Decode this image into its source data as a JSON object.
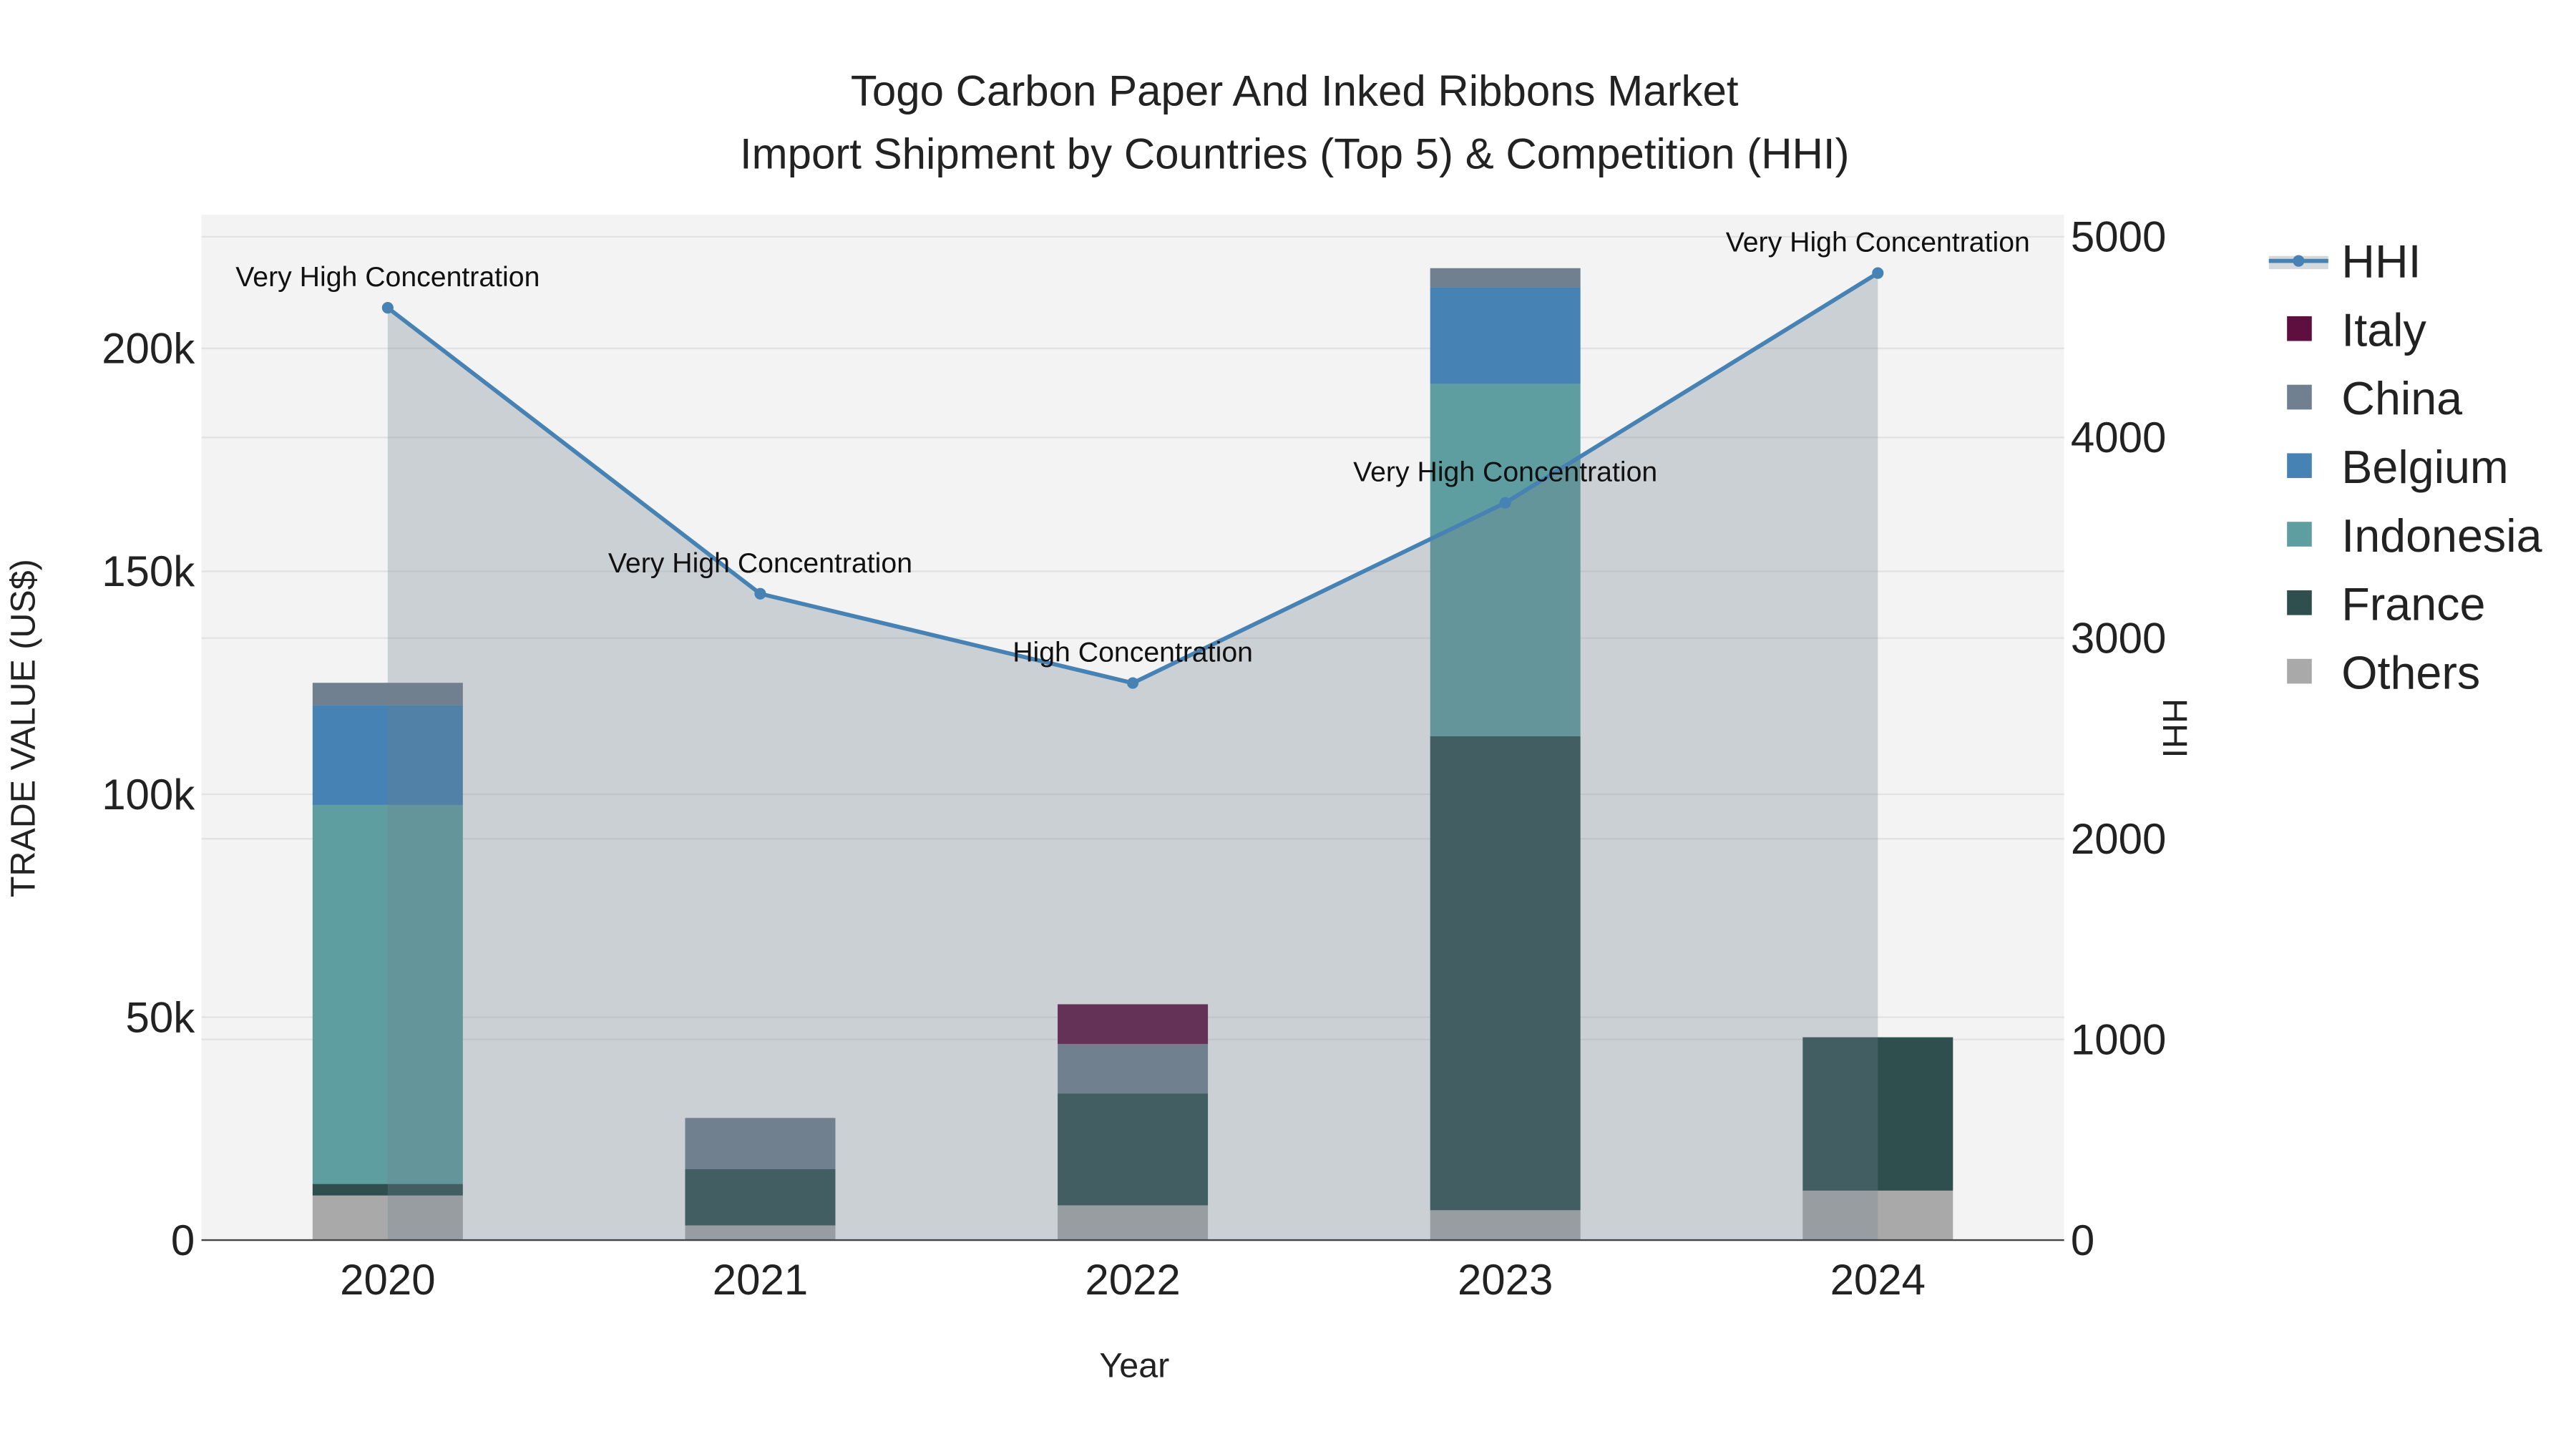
{
  "chart_data": {
    "type": "bar",
    "title_line1": "Togo Carbon Paper And Inked Ribbons Market",
    "title_line2": "Import Shipment by Countries (Top 5) & Competition (HHI)",
    "xlabel": "Year",
    "ylabel": "TRADE VALUE (US$)",
    "y2label": "HHI",
    "categories": [
      "2020",
      "2021",
      "2022",
      "2023",
      "2024"
    ],
    "ylim": [
      0,
      230000
    ],
    "y2lim": [
      0,
      5110
    ],
    "yticks": [
      {
        "v": 0,
        "label": "0"
      },
      {
        "v": 50000,
        "label": "50k"
      },
      {
        "v": 100000,
        "label": "100k"
      },
      {
        "v": 150000,
        "label": "150k"
      },
      {
        "v": 200000,
        "label": "200k"
      }
    ],
    "y2ticks": [
      {
        "v": 0,
        "label": "0"
      },
      {
        "v": 1000,
        "label": "1000"
      },
      {
        "v": 2000,
        "label": "2000"
      },
      {
        "v": 3000,
        "label": "3000"
      },
      {
        "v": 4000,
        "label": "4000"
      },
      {
        "v": 5000,
        "label": "5000"
      }
    ],
    "stack_order_bottom_to_top": [
      "Others",
      "France",
      "Indonesia",
      "Belgium",
      "China",
      "Italy"
    ],
    "series": [
      {
        "name": "Others",
        "color": "#a9a9a9",
        "values": [
          10000,
          3300,
          7800,
          6700,
          11100
        ]
      },
      {
        "name": "France",
        "color": "#2f4f4f",
        "values": [
          2600,
          12600,
          25100,
          106300,
          34400
        ]
      },
      {
        "name": "Indonesia",
        "color": "#5f9ea0",
        "values": [
          85000,
          0,
          0,
          79000,
          0
        ]
      },
      {
        "name": "Belgium",
        "color": "#4682b4",
        "values": [
          22400,
          0,
          0,
          21700,
          0
        ]
      },
      {
        "name": "China",
        "color": "#708090",
        "values": [
          5000,
          11500,
          11100,
          4300,
          0
        ]
      },
      {
        "name": "Italy",
        "color": "#5f0f3f",
        "values": [
          0,
          0,
          8900,
          0,
          0
        ]
      }
    ],
    "hhi": {
      "name": "HHI",
      "color": "#4682b4",
      "values": [
        4646,
        3221,
        2776,
        3674,
        4819
      ],
      "annotations": [
        "Very High Concentration",
        "Very High Concentration",
        "High Concentration",
        "Very High Concentration",
        "Very High Concentration"
      ]
    },
    "legend": [
      "HHI",
      "Italy",
      "China",
      "Belgium",
      "Indonesia",
      "France",
      "Others"
    ],
    "legend_placement": "right",
    "grid": true
  }
}
